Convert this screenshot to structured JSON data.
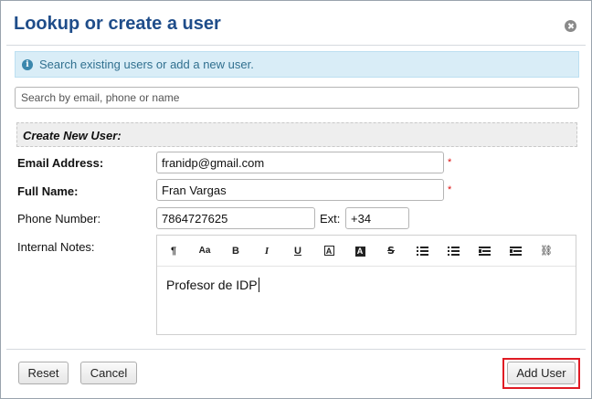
{
  "dialog": {
    "title": "Lookup or create a user"
  },
  "info_banner": {
    "text": "Search existing users or add a new user."
  },
  "search": {
    "placeholder": "Search by email, phone or name",
    "value": ""
  },
  "section": {
    "title": "Create New User:"
  },
  "form": {
    "email": {
      "label": "Email Address:",
      "value": "franidp@gmail.com"
    },
    "full_name": {
      "label": "Full Name:",
      "value": "Fran Vargas"
    },
    "phone": {
      "label": "Phone Number:",
      "value": "7864727625",
      "ext_label": "Ext:",
      "ext_value": "+34"
    },
    "notes": {
      "label": "Internal Notes:",
      "value": "Profesor de IDP"
    },
    "required_mark": "*"
  },
  "toolbar": {
    "paragraph": "¶",
    "font_size": "Aa",
    "bold": "B",
    "italic": "I",
    "underline": "U",
    "text_color": "A",
    "background_color": "A",
    "strike": "S",
    "link": "⛓"
  },
  "buttons": {
    "reset": "Reset",
    "cancel": "Cancel",
    "add_user": "Add User"
  },
  "colors": {
    "title": "#1f4d8a",
    "info_background": "#d9edf7",
    "info_text": "#31708f",
    "highlight": "#e01b24",
    "required": "#dd1111"
  }
}
